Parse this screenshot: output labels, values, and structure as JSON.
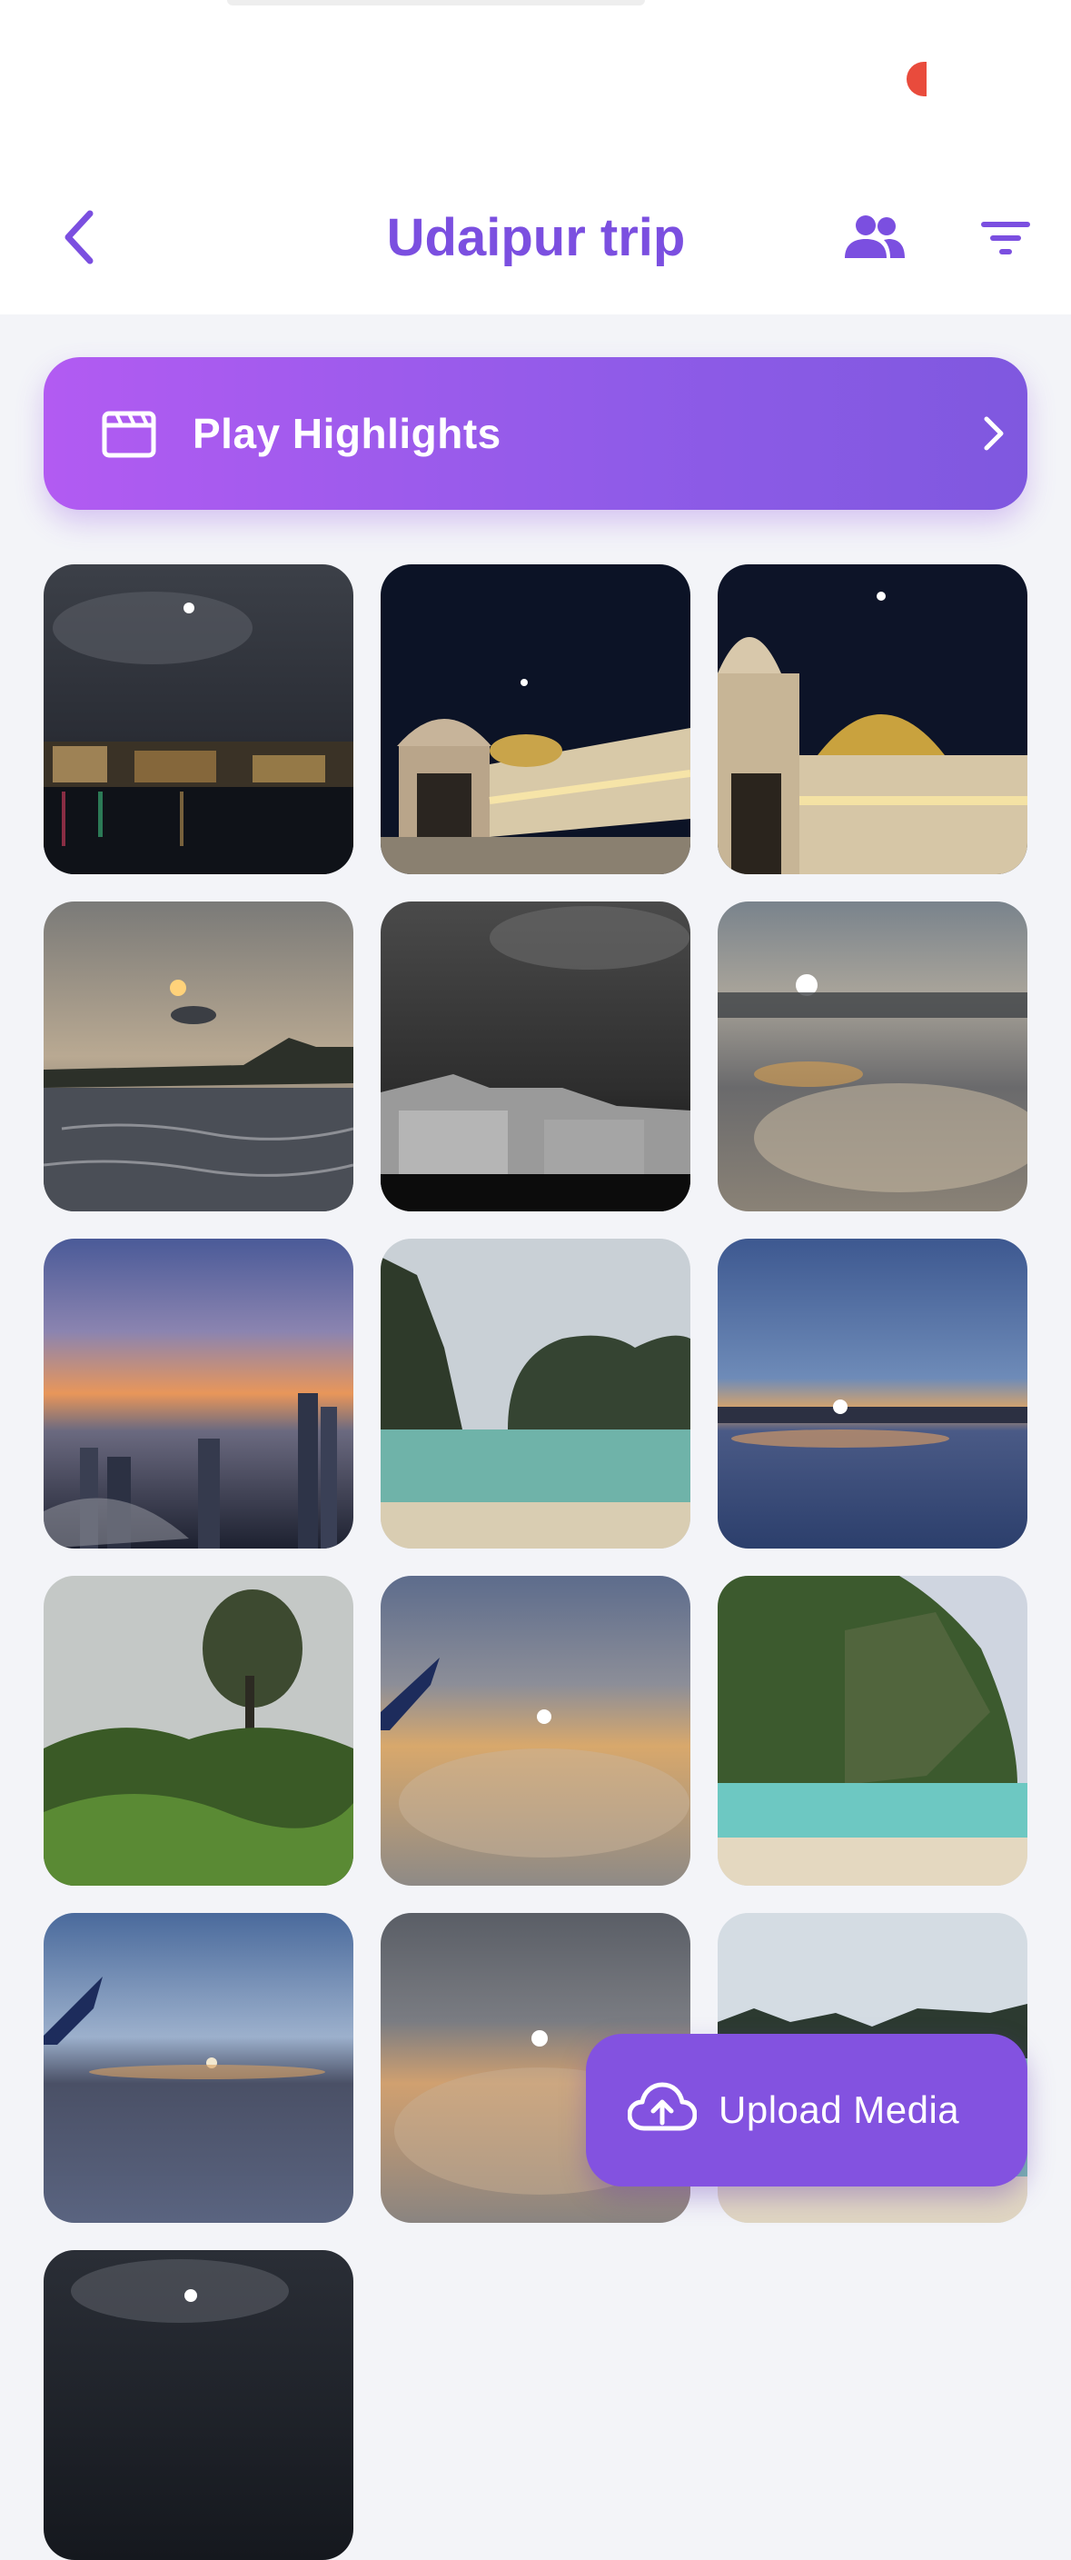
{
  "album": {
    "title": "Udaipur trip"
  },
  "highlights": {
    "label": "Play Highlights"
  },
  "upload": {
    "label": "Upload Media"
  },
  "colors": {
    "accent": "#7b4fe0",
    "highlight_gradient_start": "#b25bf2",
    "highlight_gradient_end": "#7f58df",
    "upload_button": "#8352e0",
    "background": "#f3f4f8"
  },
  "icons": {
    "back": "chevron-left-icon",
    "members": "people-icon",
    "filter": "filter-icon",
    "highlights": "clapperboard-icon",
    "highlights_go": "chevron-right-icon",
    "upload": "cloud-upload-icon"
  },
  "photos": [
    {
      "name": "photo-night-lake-city",
      "scene": "night"
    },
    {
      "name": "photo-palace-domes-night",
      "scene": "palace"
    },
    {
      "name": "photo-palace-dome-closeup",
      "scene": "palace"
    },
    {
      "name": "photo-sunset-lake-hills",
      "scene": "sunset"
    },
    {
      "name": "photo-bw-night-city",
      "scene": "bw"
    },
    {
      "name": "photo-sun-above-clouds",
      "scene": "clouds"
    },
    {
      "name": "photo-city-skyline-dusk",
      "scene": "skyline"
    },
    {
      "name": "photo-limestone-cliffs-bay",
      "scene": "beach"
    },
    {
      "name": "photo-horizon-sunrise",
      "scene": "horizon"
    },
    {
      "name": "photo-tall-tree-forest",
      "scene": "forest"
    },
    {
      "name": "photo-wing-sunset-clouds",
      "scene": "wing"
    },
    {
      "name": "photo-green-cliff-beach",
      "scene": "cliff"
    },
    {
      "name": "photo-wing-sky-clouds",
      "scene": "wing2"
    },
    {
      "name": "photo-sun-over-clouds",
      "scene": "clouds2"
    },
    {
      "name": "photo-bay-islands",
      "scene": "bay"
    },
    {
      "name": "photo-night-moon-partial",
      "scene": "night2"
    }
  ]
}
